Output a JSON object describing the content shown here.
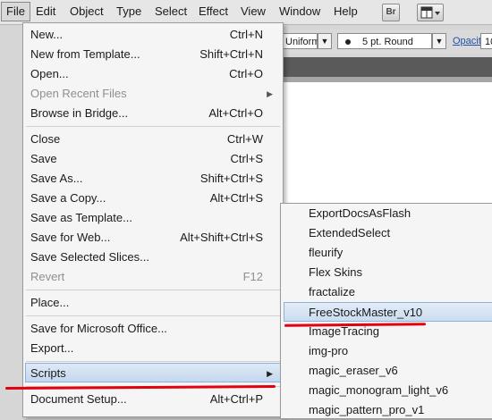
{
  "menubar": {
    "items": [
      "File",
      "Edit",
      "Object",
      "Type",
      "Select",
      "Effect",
      "View",
      "Window",
      "Help"
    ],
    "bridge_icon_label": "Br"
  },
  "controlbar": {
    "stroke_profile": "Uniform",
    "brush": "5 pt. Round",
    "opacity_label": "Opacity:",
    "opacity_value": "10"
  },
  "file_menu": {
    "items": [
      {
        "label": "New...",
        "shortcut": "Ctrl+N"
      },
      {
        "label": "New from Template...",
        "shortcut": "Shift+Ctrl+N"
      },
      {
        "label": "Open...",
        "shortcut": "Ctrl+O"
      },
      {
        "label": "Open Recent Files",
        "shortcut": ""
      },
      {
        "label": "Browse in Bridge...",
        "shortcut": "Alt+Ctrl+O"
      },
      {
        "label": "Close",
        "shortcut": "Ctrl+W"
      },
      {
        "label": "Save",
        "shortcut": "Ctrl+S"
      },
      {
        "label": "Save As...",
        "shortcut": "Shift+Ctrl+S"
      },
      {
        "label": "Save a Copy...",
        "shortcut": "Alt+Ctrl+S"
      },
      {
        "label": "Save as Template...",
        "shortcut": ""
      },
      {
        "label": "Save for Web...",
        "shortcut": "Alt+Shift+Ctrl+S"
      },
      {
        "label": "Save Selected Slices...",
        "shortcut": ""
      },
      {
        "label": "Revert",
        "shortcut": "F12"
      },
      {
        "label": "Place...",
        "shortcut": ""
      },
      {
        "label": "Save for Microsoft Office...",
        "shortcut": ""
      },
      {
        "label": "Export...",
        "shortcut": ""
      },
      {
        "label": "Scripts",
        "shortcut": ""
      },
      {
        "label": "Document Setup...",
        "shortcut": "Alt+Ctrl+P"
      }
    ],
    "submenu_arrow": "▶"
  },
  "scripts_submenu": {
    "items": [
      "ExportDocsAsFlash",
      "ExtendedSelect",
      "fleurify",
      "Flex Skins",
      "fractalize",
      "FreeStockMaster_v10",
      "ImageTracing",
      "img-pro",
      "magic_eraser_v6",
      "magic_monogram_light_v6",
      "magic_pattern_pro_v1"
    ]
  },
  "colors": {
    "highlight": "#c4d8ee",
    "annotation_underline": "#e3000f"
  }
}
